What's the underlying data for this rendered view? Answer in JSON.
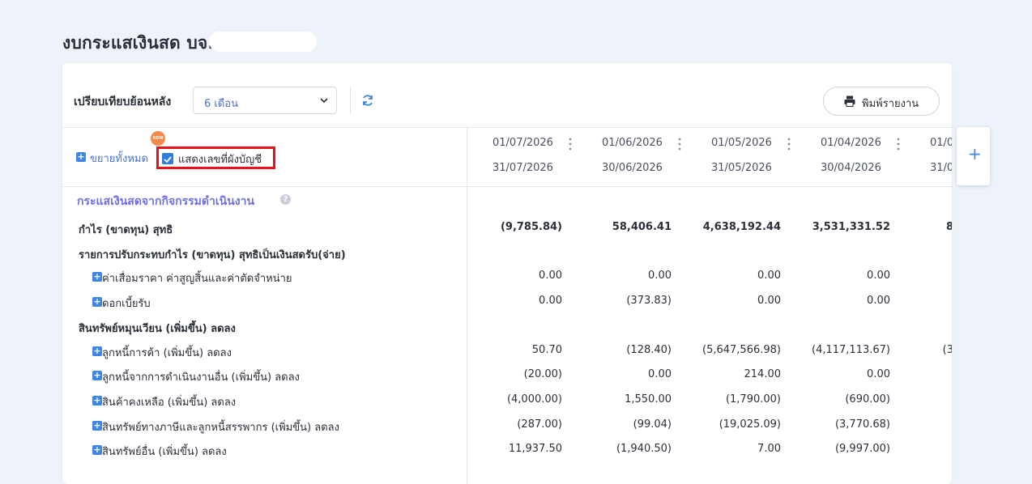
{
  "page": {
    "title": "งบกระแสเงินสด บจ."
  },
  "toolbar": {
    "compare_label": "เปรียบเทียบย้อนหลัง",
    "period_value": "6 เดือน",
    "print_label": "พิมพ์รายงาน",
    "icons": [
      "chevron-down-icon",
      "refresh-icon",
      "printer-icon"
    ]
  },
  "controls": {
    "expand_all": "ขยายทั้งหมด",
    "show_account_numbers": "แสดงเลขที่ผังบัญชี",
    "new_badge": "NEW"
  },
  "columns": [
    {
      "from": "01/07/2026",
      "to": "31/07/2026"
    },
    {
      "from": "01/06/2026",
      "to": "30/06/2026"
    },
    {
      "from": "01/05/2026",
      "to": "31/05/2026"
    },
    {
      "from": "01/04/2026",
      "to": "30/04/2026"
    },
    {
      "from": "01/0",
      "to": "31/0"
    }
  ],
  "section": {
    "title": "กระแสเงินสดจากกิจกรรมดำเนินงาน",
    "help": "?"
  },
  "rows": [
    {
      "label": "กำไร (ขาดทุน) สุทธิ",
      "values": [
        "(9,785.84)",
        "58,406.41",
        "4,638,192.44",
        "3,531,331.52",
        "8"
      ]
    },
    {
      "label": "รายการปรับกระทบกำไร (ขาดทุน) สุทธิเป็นเงินสดรับ(จ่าย)",
      "values": [
        "",
        "",
        "",
        "",
        ""
      ]
    },
    {
      "label": "ค่าเสื่อมราคา ค่าสูญสิ้นและค่าตัดจำหน่าย",
      "values": [
        "0.00",
        "0.00",
        "0.00",
        "0.00",
        ""
      ]
    },
    {
      "label": "ดอกเบี้ยรับ",
      "values": [
        "0.00",
        "(373.83)",
        "0.00",
        "0.00",
        ""
      ]
    },
    {
      "label": "สินทรัพย์หมุนเวียน (เพิ่มขึ้น) ลดลง",
      "values": [
        "",
        "",
        "",
        "",
        ""
      ]
    },
    {
      "label": "ลูกหนี้การค้า (เพิ่มขึ้น) ลดลง",
      "values": [
        "50.70",
        "(128.40)",
        "(5,647,566.98)",
        "(4,117,113.67)",
        "(3"
      ]
    },
    {
      "label": "ลูกหนี้จากการดำเนินงานอื่น (เพิ่มขึ้น) ลดลง",
      "values": [
        "(20.00)",
        "0.00",
        "214.00",
        "0.00",
        ""
      ]
    },
    {
      "label": "สินค้าคงเหลือ (เพิ่มขึ้น) ลดลง",
      "values": [
        "(4,000.00)",
        "1,550.00",
        "(1,790.00)",
        "(690.00)",
        ""
      ]
    },
    {
      "label": "สินทรัพย์ทางภาษีและลูกหนี้สรรพากร (เพิ่มขึ้น) ลดลง",
      "values": [
        "(287.00)",
        "(99.04)",
        "(19,025.09)",
        "(3,770.68)",
        ""
      ]
    },
    {
      "label": "สินทรัพย์อื่น (เพิ่มขึ้น) ลดลง",
      "values": [
        "11,937.50",
        "(1,940.50)",
        "7.00",
        "(9,997.00)",
        ""
      ]
    }
  ],
  "add_column": "+",
  "colors": {
    "accent": "#3d86e4",
    "section": "#6f6fe0",
    "highlight_border": "#e8131a",
    "background": "#eef2f9"
  }
}
